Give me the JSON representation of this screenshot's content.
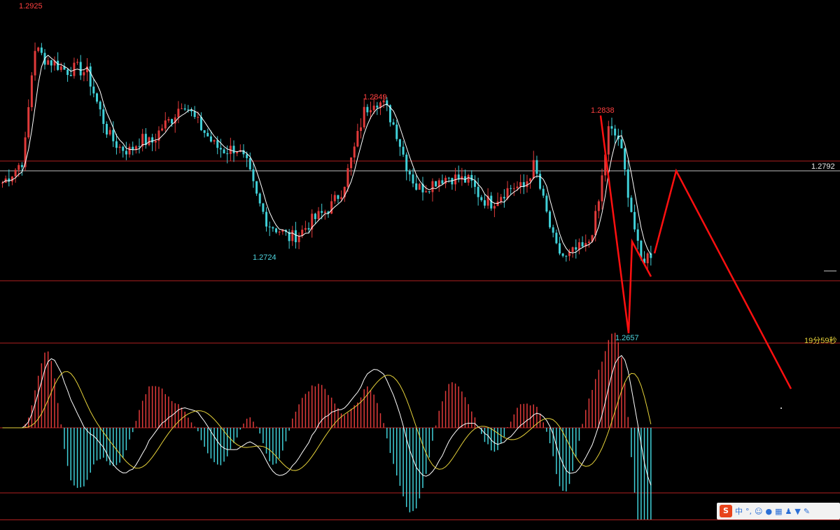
{
  "colors": {
    "up": "#e03a3a",
    "down": "#40d0d8",
    "ma": "#ffffff",
    "signal": "#e6d23a",
    "forecast": "#ff1010",
    "grid": "#b02020",
    "level": "#bdbdbd"
  },
  "price_labels": {
    "high_1": "1.2925",
    "high_2": "1.2849",
    "high_3": "1.2838",
    "low_1": "1.2724",
    "low_2": "1.2657",
    "level": "1.2792",
    "countdown": "19分59秒"
  },
  "ime_toolbar": {
    "logo": "S",
    "lang": "中",
    "punct": "°,",
    "icons": [
      "emoji-icon",
      "mic-icon",
      "keyboard-icon",
      "user-icon",
      "shirt-icon",
      "wrench-icon"
    ]
  },
  "chart_data": {
    "type": "candlestick",
    "price_range": [
      1.264,
      1.293
    ],
    "key_levels": [
      1.2792
    ],
    "annotated_extremes": [
      {
        "label": "1.2925",
        "kind": "high"
      },
      {
        "label": "1.2849",
        "kind": "high"
      },
      {
        "label": "1.2724",
        "kind": "low"
      },
      {
        "label": "1.2838",
        "kind": "high"
      },
      {
        "label": "1.2657",
        "kind": "low"
      }
    ],
    "close_path": [
      1.2775,
      1.2784,
      1.2795,
      1.289,
      1.288,
      1.2876,
      1.287,
      1.2872,
      1.2868,
      1.284,
      1.2815,
      1.2805,
      1.2802,
      1.2812,
      1.2808,
      1.2822,
      1.283,
      1.2845,
      1.283,
      1.2818,
      1.2806,
      1.2802,
      1.2805,
      1.279,
      1.276,
      1.274,
      1.2735,
      1.2728,
      1.2732,
      1.2742,
      1.2748,
      1.2756,
      1.277,
      1.28,
      1.2835,
      1.2846,
      1.284,
      1.282,
      1.279,
      1.277,
      1.2772,
      1.2778,
      1.278,
      1.2778,
      1.2776,
      1.2762,
      1.2758,
      1.2766,
      1.2772,
      1.277,
      1.279,
      1.2755,
      1.272,
      1.271,
      1.2718,
      1.272,
      1.2752,
      1.282,
      1.2812,
      1.276,
      1.2708,
      1.2715
    ],
    "forecast_path": [
      1.2715,
      1.2785,
      1.26
    ]
  }
}
